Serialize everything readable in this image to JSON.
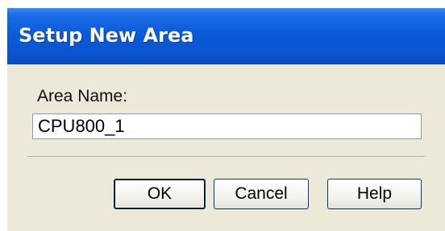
{
  "window": {
    "title": "Setup New Area"
  },
  "form": {
    "area_name_label": "Area Name:",
    "area_name_value": "CPU800_1"
  },
  "buttons": {
    "ok_label": "OK",
    "cancel_label": "Cancel",
    "help_label": "Help"
  },
  "colors": {
    "titlebar": "#0a5ad9",
    "dialog_background": "#ece9d8",
    "button_border": "#003c74"
  }
}
